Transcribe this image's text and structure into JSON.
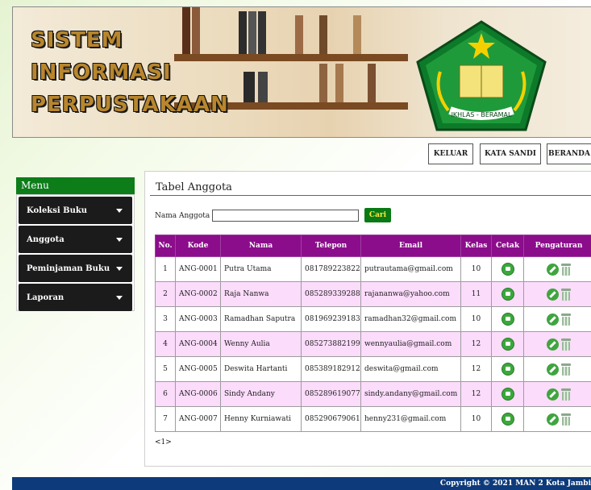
{
  "banner": {
    "title_lines": [
      "SISTEM",
      "INFORMASI",
      "PERPUSTAKAAN"
    ],
    "logo_ribbon": "IKHLAS - BERAMAL"
  },
  "top_actions": {
    "logout": "KELUAR",
    "password": "KATA SANDI",
    "home": "BERANDA"
  },
  "sidebar": {
    "title": "Menu",
    "items": [
      {
        "label": "Koleksi Buku"
      },
      {
        "label": "Anggota"
      },
      {
        "label": "Peminjaman Buku"
      },
      {
        "label": "Laporan"
      }
    ]
  },
  "main": {
    "title": "Tabel Anggota",
    "search": {
      "label": "Nama Anggota :",
      "value": "",
      "button": "Cari"
    },
    "columns": [
      "No.",
      "Kode",
      "Nama",
      "Telepon",
      "Email",
      "Kelas",
      "Cetak",
      "Pengaturan"
    ],
    "rows": [
      {
        "no": "1",
        "kode": "ANG-0001",
        "nama": "Putra Utama",
        "telepon": "081789223822",
        "email": "putrautama@gmail.com",
        "kelas": "10"
      },
      {
        "no": "2",
        "kode": "ANG-0002",
        "nama": "Raja Nanwa",
        "telepon": "085289339288",
        "email": "rajananwa@yahoo.com",
        "kelas": "11"
      },
      {
        "no": "3",
        "kode": "ANG-0003",
        "nama": "Ramadhan Saputra",
        "telepon": "081969239183",
        "email": "ramadhan32@gmail.com",
        "kelas": "10"
      },
      {
        "no": "4",
        "kode": "ANG-0004",
        "nama": "Wenny Aulia",
        "telepon": "085273882199",
        "email": "wennyaulia@gmail.com",
        "kelas": "12"
      },
      {
        "no": "5",
        "kode": "ANG-0005",
        "nama": "Deswita Hartanti",
        "telepon": "085389182912",
        "email": "deswita@gmail.com",
        "kelas": "12"
      },
      {
        "no": "6",
        "kode": "ANG-0006",
        "nama": "Sindy Andany",
        "telepon": "085289619077",
        "email": "sindy.andany@gmail.com",
        "kelas": "12"
      },
      {
        "no": "7",
        "kode": "ANG-0007",
        "nama": "Henny Kurniawati",
        "telepon": "085290679061",
        "email": "henny231@gmail.com",
        "kelas": "10"
      }
    ],
    "pagination": "<1>"
  },
  "footer": {
    "copyright": "Copyright © 2021 MAN 2 Kota Jambi"
  },
  "colors": {
    "menu_header": "#0d7d1a",
    "menu_item": "#1b1b1b",
    "table_header": "#8b0d8b",
    "row_alt": "#fbdcfb",
    "search_button": "#0a7a14",
    "footer": "#0d3a7a"
  },
  "icons": {
    "print": "print-icon",
    "edit": "edit-icon",
    "delete": "trash-icon",
    "caret": "caret-down-icon"
  }
}
